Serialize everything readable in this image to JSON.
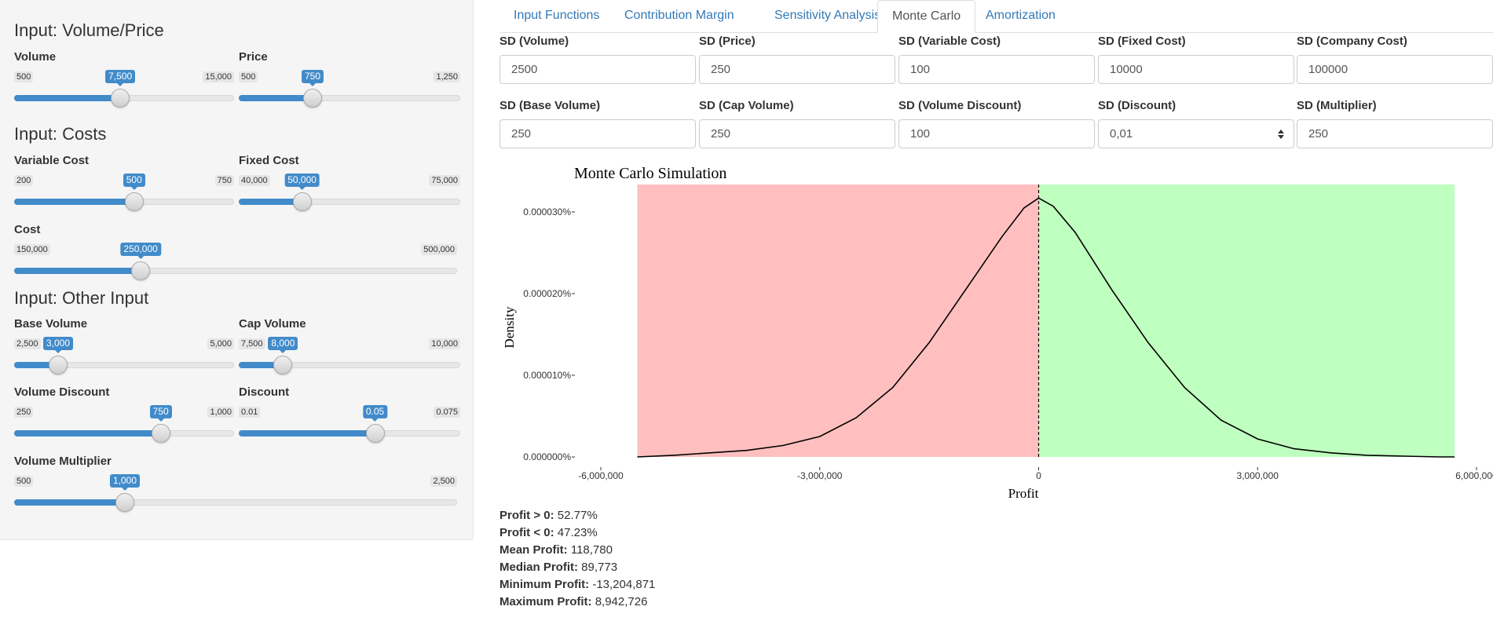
{
  "sidebar": {
    "sections": [
      {
        "title": "Input: Volume/Price"
      },
      {
        "title": "Input: Costs"
      },
      {
        "title": "Input: Other Input"
      }
    ],
    "sliders": [
      {
        "label": "Volume",
        "min": "500",
        "max": "15,000",
        "value": "7,500",
        "fraction": 0.4827
      },
      {
        "label": "Price",
        "min": "500",
        "max": "1,250",
        "value": "750",
        "fraction": 0.3333
      },
      {
        "label": "Variable Cost",
        "min": "200",
        "max": "750",
        "value": "500",
        "fraction": 0.5455
      },
      {
        "label": "Fixed Cost",
        "min": "40,000",
        "max": "75,000",
        "value": "50,000",
        "fraction": 0.2857
      },
      {
        "label": "Cost",
        "min": "150,000",
        "max": "500,000",
        "value": "250,000",
        "fraction": 0.2857
      },
      {
        "label": "Base Volume",
        "min": "2,500",
        "max": "5,000",
        "value": "3,000",
        "fraction": 0.2
      },
      {
        "label": "Cap Volume",
        "min": "7,500",
        "max": "10,000",
        "value": "8,000",
        "fraction": 0.2
      },
      {
        "label": "Volume Discount",
        "min": "250",
        "max": "1,000",
        "value": "750",
        "fraction": 0.6667
      },
      {
        "label": "Discount",
        "min": "0.01",
        "max": "0.075",
        "value": "0.05",
        "fraction": 0.6154
      },
      {
        "label": "Volume Multiplier",
        "min": "500",
        "max": "2,500",
        "value": "1,000",
        "fraction": 0.25
      }
    ]
  },
  "tabs": [
    {
      "label": "Input Functions",
      "active": false
    },
    {
      "label": "Contribution Margin",
      "active": false
    },
    {
      "label": "Sensitivity Analysis",
      "active": false
    },
    {
      "label": "Monte Carlo",
      "active": true
    },
    {
      "label": "Amortization",
      "active": false
    }
  ],
  "inputs": [
    {
      "label": "SD (Volume)",
      "value": "2500"
    },
    {
      "label": "SD (Price)",
      "value": "250"
    },
    {
      "label": "SD (Variable Cost)",
      "value": "100"
    },
    {
      "label": "SD (Fixed Cost)",
      "value": "10000"
    },
    {
      "label": "SD (Company Cost)",
      "value": "100000"
    },
    {
      "label": "SD (Base Volume)",
      "value": "250"
    },
    {
      "label": "SD (Cap Volume)",
      "value": "250"
    },
    {
      "label": "SD (Volume Discount)",
      "value": "100"
    },
    {
      "label": "SD (Discount)",
      "value": "0,01"
    },
    {
      "label": "SD (Multiplier)",
      "value": "250"
    }
  ],
  "chart_data": {
    "type": "area",
    "title": "Monte Carlo Simulation",
    "xlabel": "Profit",
    "ylabel": "Density",
    "xlim": [
      -6000000,
      6000000
    ],
    "ylim": [
      0,
      3e-06
    ],
    "x_ticks": [
      "-6,000,000",
      "-3,000,000",
      "0",
      "3,000,000",
      "6,000,000"
    ],
    "y_ticks": [
      "0.000000%",
      "0.000010%",
      "0.000020%",
      "0.000030%"
    ],
    "regions": [
      {
        "range": [
          -5500000,
          0
        ],
        "color": "#ffbfbf"
      },
      {
        "range": [
          0,
          5700000
        ],
        "color": "#bfffbf"
      }
    ],
    "vline_x": 0,
    "series": [
      {
        "x": [
          -5500000,
          -5000000,
          -4500000,
          -4000000,
          -3500000,
          -3000000,
          -2500000,
          -2000000,
          -1500000,
          -1000000,
          -500000,
          -200000,
          0,
          200000,
          500000,
          1000000,
          1500000,
          2000000,
          2500000,
          3000000,
          3500000,
          4000000,
          4500000,
          5000000,
          5500000,
          5700000
        ],
        "y": [
          0.0,
          2e-08,
          5e-08,
          8e-08,
          1.4e-07,
          2.5e-07,
          4.8e-07,
          8.5e-07,
          1.4e-06,
          2.05e-06,
          2.7e-06,
          3.05e-06,
          3.17e-06,
          3.07e-06,
          2.75e-06,
          2.05e-06,
          1.4e-06,
          8.5e-07,
          4.5e-07,
          2.2e-07,
          1e-07,
          5e-08,
          2e-08,
          1e-08,
          0.0,
          0.0
        ]
      }
    ]
  },
  "stats": [
    {
      "label": "Profit > 0:",
      "value": "52.77%"
    },
    {
      "label": "Profit < 0:",
      "value": "47.23%"
    },
    {
      "label": "Mean Profit:",
      "value": "118,780"
    },
    {
      "label": "Median Profit:",
      "value": "89,773"
    },
    {
      "label": "Minimum Profit:",
      "value": "-13,204,871"
    },
    {
      "label": "Maximum Profit:",
      "value": "8,942,726"
    }
  ]
}
